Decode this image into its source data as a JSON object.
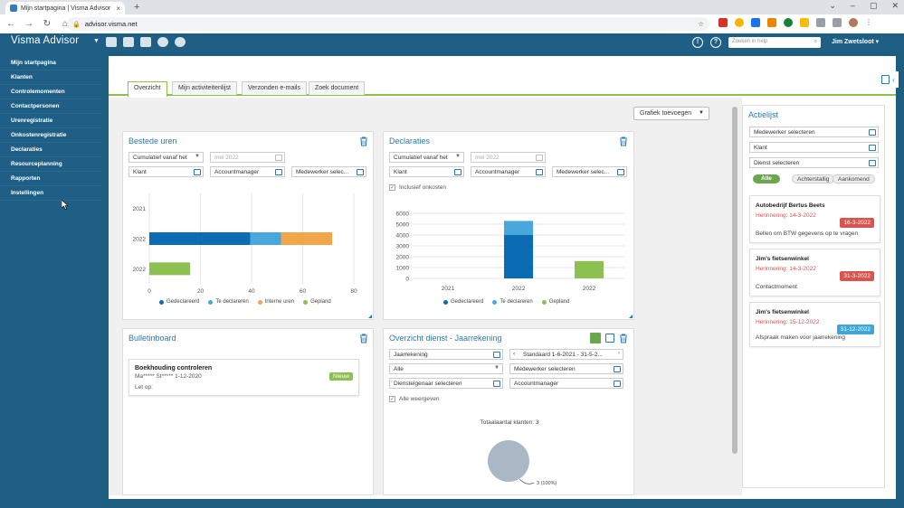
{
  "browser": {
    "tab_title": "Mijn startpagina | Visma Advisor",
    "url": "advisor.visma.net"
  },
  "app": {
    "brand": "Visma Advisor",
    "search_placeholder": "Zoeken in help",
    "user": "Jim Zwetsloot"
  },
  "sidebar": {
    "items": [
      {
        "label": "Mijn startpagina"
      },
      {
        "label": "Klanten"
      },
      {
        "label": "Controlemomenten"
      },
      {
        "label": "Contactpersonen"
      },
      {
        "label": "Urenregistratie"
      },
      {
        "label": "Onkostenregistratie"
      },
      {
        "label": "Declaraties"
      },
      {
        "label": "Resourceplanning"
      },
      {
        "label": "Rapporten"
      },
      {
        "label": "Instellingen"
      }
    ]
  },
  "tabs": [
    "Overzicht",
    "Mijn activiteitenlijst",
    "Verzonden e-mails",
    "Zoek document"
  ],
  "grafiek_button": "Grafiek toevoegen",
  "bestede_uren": {
    "title": "Bestede uren",
    "filter1": "Cumulatief vanaf het",
    "date_placeholder": "mei 2022",
    "klant": "Klant",
    "accountmanager": "Accountmanager",
    "medewerker": "Medewerker selec...",
    "chart_data": {
      "type": "bar",
      "orientation": "horizontal",
      "categories": [
        "2021",
        "2022",
        "2022"
      ],
      "series": [
        {
          "name": "Gedeclareerd",
          "color": "#0b6cb4",
          "values": [
            0,
            39.5,
            0
          ]
        },
        {
          "name": "Te declareren",
          "color": "#49a7dc",
          "values": [
            0,
            12,
            0
          ]
        },
        {
          "name": "Interne uren",
          "color": "#f0a649",
          "values": [
            0,
            20,
            0
          ]
        },
        {
          "name": "Gepland",
          "color": "#8cc152",
          "values": [
            0,
            0,
            16
          ]
        }
      ],
      "xlim": [
        0,
        80
      ],
      "xticks": [
        "0",
        "20",
        "40",
        "60",
        "80"
      ],
      "grid": true,
      "legend": "bottom"
    }
  },
  "declaraties": {
    "title": "Declaraties",
    "filter1": "Cumulatief vanaf het",
    "date_placeholder": "mei 2022",
    "klant": "Klant",
    "accountmanager": "Accountmanager",
    "medewerker": "Medewerker selec...",
    "checkbox": "Inclusief onkosten",
    "chart_data": {
      "type": "bar",
      "stacked": true,
      "categories": [
        "2021",
        "2022",
        "2022"
      ],
      "series": [
        {
          "name": "Gedeclareerd",
          "color": "#0b6cb4",
          "values": [
            0,
            4000,
            0
          ]
        },
        {
          "name": "Te declareren",
          "color": "#49a7dc",
          "values": [
            0,
            1300,
            0
          ]
        },
        {
          "name": "Gepland",
          "color": "#8cc152",
          "values": [
            0,
            0,
            1600
          ]
        }
      ],
      "ylim": [
        0,
        6000
      ],
      "yticks": [
        "0",
        "1000",
        "2000",
        "3000",
        "4000",
        "5000",
        "6000"
      ],
      "grid": true,
      "legend": "bottom"
    }
  },
  "bulletinboard": {
    "title": "Bulletinboard",
    "item_title": "Boekhouding controleren",
    "item_meta": "Ma***** St***** 1-12-2020",
    "item_body": "Let op:",
    "badge": "Nieuw"
  },
  "overzicht_dienst": {
    "title": "Overzicht dienst - Jaarrekening",
    "sel1": "Jaarrekening",
    "sel2": "Standaard 1-6-2021 - 31-5-2...",
    "sel3": "Alle",
    "sel4": "Medewerker selecteren",
    "sel5": "Diensteigenaar selecteren",
    "sel6": "Accountmanager",
    "checkbox": "Alle weergeven",
    "total_label": "Totaalaantal klanten: 3",
    "chart_data": {
      "type": "pie",
      "slices": [
        {
          "label": "3 (100%)",
          "value": 3,
          "color": "#a9b8c4"
        }
      ]
    }
  },
  "actielijst": {
    "title": "Actielijst",
    "medewerker": "Medewerker selecteren",
    "klant": "Klant",
    "dienst": "Dienst selecteren",
    "filters": [
      "Alle",
      "Achterstallig",
      "Aankomend"
    ],
    "tasks": [
      {
        "name": "Autobedrijf Bertus Beets",
        "reminder": "Herinnering: 14-3-2022",
        "date": "16-3-2022",
        "date_color": "#d9534f",
        "desc": "Bellen om BTW gegevens op te vragen"
      },
      {
        "name": "Jim's fietsenwinkel",
        "reminder": "Herinnering: 14-3-2022",
        "date": "31-3-2022",
        "date_color": "#d9534f",
        "desc": "Contactmoment"
      },
      {
        "name": "Jim's fietsenwinkel",
        "reminder": "Herinnering: 15-12-2022",
        "date": "31-12-2022",
        "date_color": "#3ea6d8",
        "desc": "Afspraak maken voor jaarrekening"
      }
    ]
  }
}
